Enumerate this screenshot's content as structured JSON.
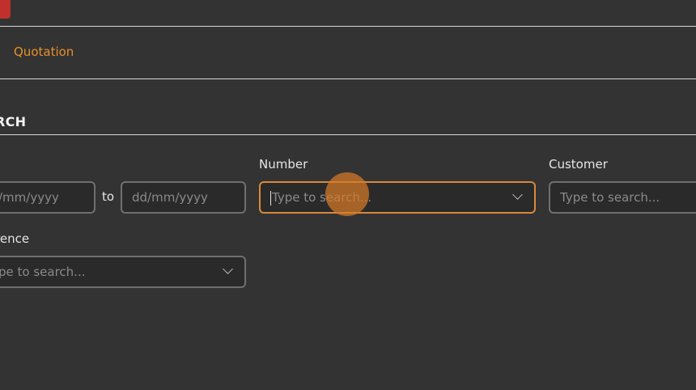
{
  "nav": {
    "tab_label": "Quotation"
  },
  "search": {
    "title": "RCH",
    "date_label": ":",
    "date_from_placeholder": "/mm/yyyy",
    "to_label": "to",
    "date_to_placeholder": "dd/mm/yyyy",
    "number_label": "Number",
    "number_placeholder": "Type to search...",
    "customer_label": "Customer",
    "customer_placeholder": "Type to search...",
    "reference_label": "rence",
    "reference_placeholder": "pe to search..."
  },
  "colors": {
    "accent": "#e8902a",
    "focus_border": "#d9893a",
    "background": "#333333",
    "app_icon": "#c0312b"
  },
  "icons": {
    "dropdown": "chevron-down-icon",
    "app": "app-icon"
  }
}
